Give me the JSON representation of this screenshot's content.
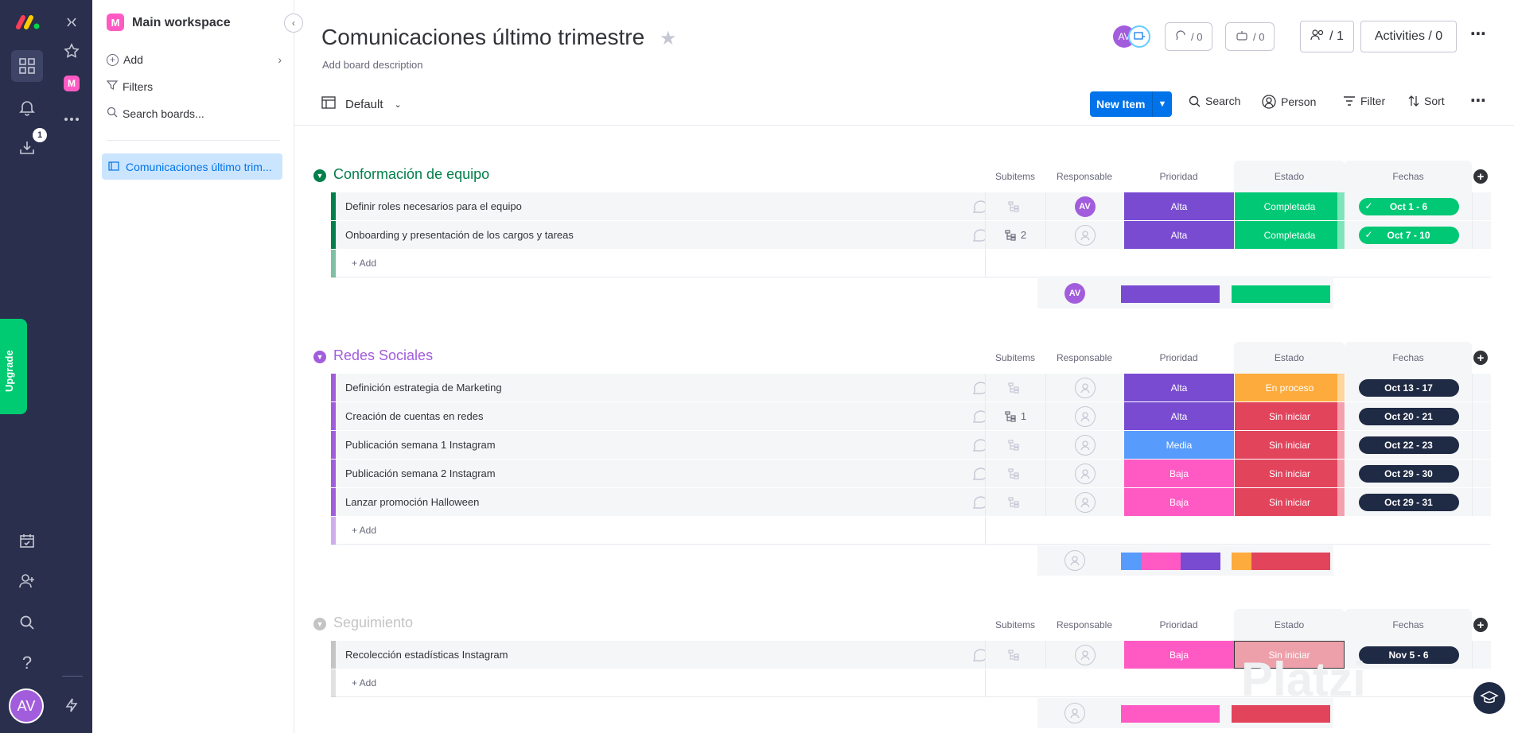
{
  "rail": {
    "notifications_badge": "1",
    "upgrade_label": "Upgrade",
    "user_initials": "AV"
  },
  "workspace": {
    "logo_letter": "M",
    "title": "Main workspace",
    "add_label": "Add",
    "filters_label": "Filters",
    "search_placeholder": "Search boards...",
    "board_item": "Comunicaciones último trim..."
  },
  "header": {
    "title": "Comunicaciones último trimestre",
    "description": "Add board description",
    "avatar_initials": "AV",
    "updates_count": "/ 0",
    "integrations_count": "/ 0",
    "members_label": "/ 1",
    "activities_label": "Activities / 0"
  },
  "toolbar": {
    "view_label": "Default",
    "new_item_label": "New Item",
    "search_label": "Search",
    "person_label": "Person",
    "filter_label": "Filter",
    "sort_label": "Sort"
  },
  "columns": {
    "subitems": "Subitems",
    "responsable": "Responsable",
    "prioridad": "Prioridad",
    "estado": "Estado",
    "fechas": "Fechas"
  },
  "add_row_label": "+ Add",
  "colors": {
    "green_group": "#037f4c",
    "purple_group": "#a25ddc",
    "gray_group": "#c4c4c4",
    "alta": "#784bd1",
    "media": "#579bfc",
    "baja": "#ff5ac4",
    "completada": "#00c875",
    "en_proceso": "#fdab3d",
    "sin_iniciar": "#e2445c",
    "date_dark": "#1f2a44"
  },
  "groups": [
    {
      "title": "Conformación de equipo",
      "color": "#037f4c",
      "rows": [
        {
          "name": "Definir roles necesarios para el equipo",
          "subitems": "",
          "owner": "AV",
          "prioridad": "Alta",
          "estado": "Completada",
          "fechas": "Oct 1 - 6",
          "done": true
        },
        {
          "name": "Onboarding y presentación de los cargos y tareas",
          "subitems": "2",
          "owner": "",
          "prioridad": "Alta",
          "estado": "Completada",
          "fechas": "Oct 7 - 10",
          "done": true
        }
      ]
    },
    {
      "title": "Redes Sociales",
      "color": "#a25ddc",
      "rows": [
        {
          "name": "Definición estrategia de Marketing",
          "subitems": "",
          "owner": "",
          "prioridad": "Alta",
          "estado": "En proceso",
          "fechas": "Oct 13 - 17",
          "done": false
        },
        {
          "name": "Creación de cuentas en redes",
          "subitems": "1",
          "owner": "",
          "prioridad": "Alta",
          "estado": "Sin iniciar",
          "fechas": "Oct 20 - 21",
          "done": false
        },
        {
          "name": "Publicación semana 1 Instagram",
          "subitems": "",
          "owner": "",
          "prioridad": "Media",
          "estado": "Sin iniciar",
          "fechas": "Oct 22 - 23",
          "done": false
        },
        {
          "name": "Publicación semana 2 Instagram",
          "subitems": "",
          "owner": "",
          "prioridad": "Baja",
          "estado": "Sin iniciar",
          "fechas": "Oct 29 - 30",
          "done": false
        },
        {
          "name": "Lanzar promoción Halloween",
          "subitems": "",
          "owner": "",
          "prioridad": "Baja",
          "estado": "Sin iniciar",
          "fechas": "Oct 29 - 31",
          "done": false
        }
      ]
    },
    {
      "title": "Seguimiento",
      "color": "#c4c4c4",
      "rows": [
        {
          "name": "Recolección estadísticas Instagram",
          "subitems": "",
          "owner": "",
          "prioridad": "Baja",
          "estado": "Sin iniciar",
          "fechas": "Nov 5 - 6",
          "done": false
        }
      ]
    }
  ]
}
